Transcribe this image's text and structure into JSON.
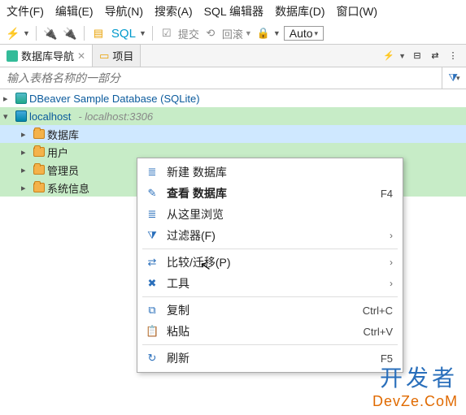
{
  "menu": {
    "items": [
      "文件(F)",
      "编辑(E)",
      "导航(N)",
      "搜索(A)",
      "SQL 编辑器",
      "数据库(D)",
      "窗口(W)"
    ]
  },
  "toolbar": {
    "sql_label": "SQL",
    "commit_label": "提交",
    "rollback_label": "回滚",
    "auto_label": "Auto"
  },
  "tabs": {
    "nav": "数据库导航",
    "projects": "项目"
  },
  "search": {
    "placeholder": "输入表格名称的一部分"
  },
  "tree": {
    "conn1": {
      "label": "DBeaver Sample Database (SQLite)"
    },
    "conn2": {
      "label": "localhost",
      "hint": "- localhost:3306"
    },
    "children": [
      {
        "label": "数据库"
      },
      {
        "label": "用户"
      },
      {
        "label": "管理员"
      },
      {
        "label": "系统信息"
      }
    ]
  },
  "ctx": {
    "items": [
      {
        "icon": "≣",
        "label": "新建 数据库",
        "sc": "",
        "sub": false
      },
      {
        "icon": "✎",
        "label": "查看 数据库",
        "sc": "F4",
        "sub": false,
        "bold": true
      },
      {
        "icon": "≣",
        "label": "从这里浏览",
        "sc": "",
        "sub": false
      },
      {
        "icon": "⧩",
        "label": "过滤器(F)",
        "sc": "",
        "sub": true
      },
      {
        "sep": true
      },
      {
        "icon": "⇄",
        "label": "比较/迁移(P)",
        "sc": "",
        "sub": true
      },
      {
        "icon": "✖",
        "label": "工具",
        "sc": "",
        "sub": true
      },
      {
        "sep": true
      },
      {
        "icon": "⧉",
        "label": "复制",
        "sc": "Ctrl+C",
        "sub": false
      },
      {
        "icon": "📋",
        "label": "粘贴",
        "sc": "Ctrl+V",
        "sub": false
      },
      {
        "sep": true
      },
      {
        "icon": "↻",
        "label": "刷新",
        "sc": "F5",
        "sub": false
      }
    ]
  },
  "watermark": {
    "l1": "开发者",
    "l2": "DevZe.CoM"
  }
}
